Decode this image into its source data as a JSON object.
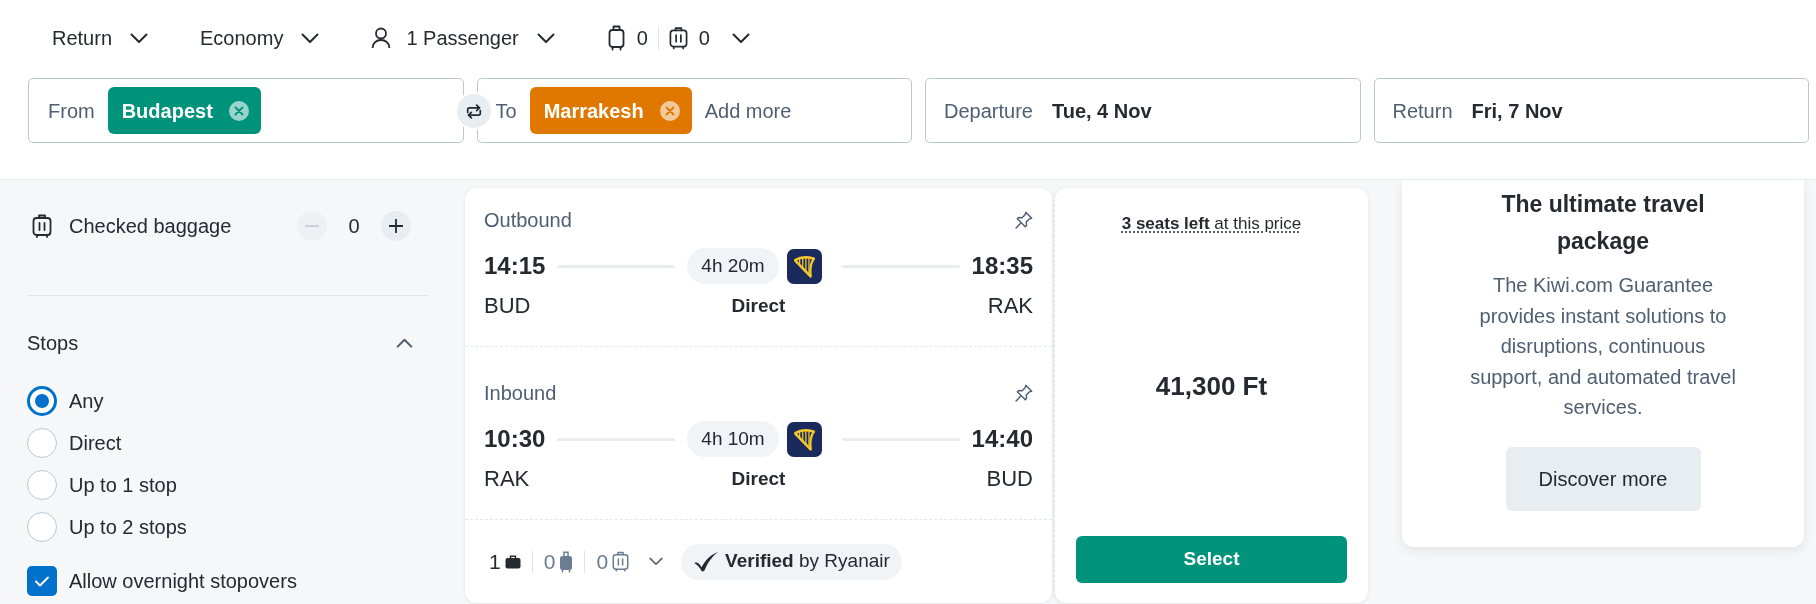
{
  "trip_bar": {
    "dropdowns": [
      {
        "kind": "trip_type",
        "label": "Return"
      },
      {
        "kind": "cabin_class",
        "label": "Economy"
      },
      {
        "kind": "passengers",
        "label": "1 Passenger"
      }
    ],
    "bags": [
      {
        "kind": "cabin",
        "count": "0"
      },
      {
        "kind": "checked",
        "count": "0"
      }
    ]
  },
  "search": {
    "from": {
      "label": "From",
      "places": [
        {
          "name": "Budapest",
          "color": "#00937c"
        }
      ]
    },
    "to": {
      "label": "To",
      "places": [
        {
          "name": "Marrakesh",
          "color": "#e07800"
        }
      ],
      "placeholder": "Add more"
    },
    "dates": [
      {
        "label": "Departure",
        "value": "Tue, 4 Nov"
      },
      {
        "label": "Return",
        "value": "Fri, 7 Nov"
      }
    ]
  },
  "filters": {
    "checked_baggage": {
      "label": "Checked baggage",
      "value": "0",
      "minus_disabled": true,
      "plus_disabled": false
    },
    "stops": {
      "title": "Stops",
      "expanded": true,
      "options": [
        {
          "label": "Any",
          "selected": true
        },
        {
          "label": "Direct",
          "selected": false
        },
        {
          "label": "Up to 1 stop",
          "selected": false
        },
        {
          "label": "Up to 2 stops",
          "selected": false
        }
      ]
    },
    "options": [
      {
        "label": "Allow overnight stopovers",
        "checked": true
      }
    ]
  },
  "result": {
    "legs": [
      {
        "label": "Outbound",
        "depart_time": "14:15",
        "depart_code": "BUD",
        "duration": "4h 20m",
        "stops": "Direct",
        "arrive_time": "18:35",
        "arrive_code": "RAK"
      },
      {
        "label": "Inbound",
        "depart_time": "10:30",
        "depart_code": "RAK",
        "duration": "4h 10m",
        "stops": "Direct",
        "arrive_time": "14:40",
        "arrive_code": "BUD"
      }
    ],
    "bags": [
      {
        "kind": "personal",
        "count": "1",
        "included": true
      },
      {
        "kind": "cabin",
        "count": "0",
        "included": false
      },
      {
        "kind": "checked",
        "count": "0",
        "included": false
      }
    ],
    "verified": "**Verified** by Ryanair",
    "seats": "**3 seats left** at this price",
    "price": "41,300 Ft",
    "button": "Select"
  },
  "promo": {
    "title": "The ultimate travel package",
    "text": "The Kiwi.com Guarantee provides instant solutions to disruptions, continuous support, and automated travel services.",
    "button": "Discover more"
  }
}
